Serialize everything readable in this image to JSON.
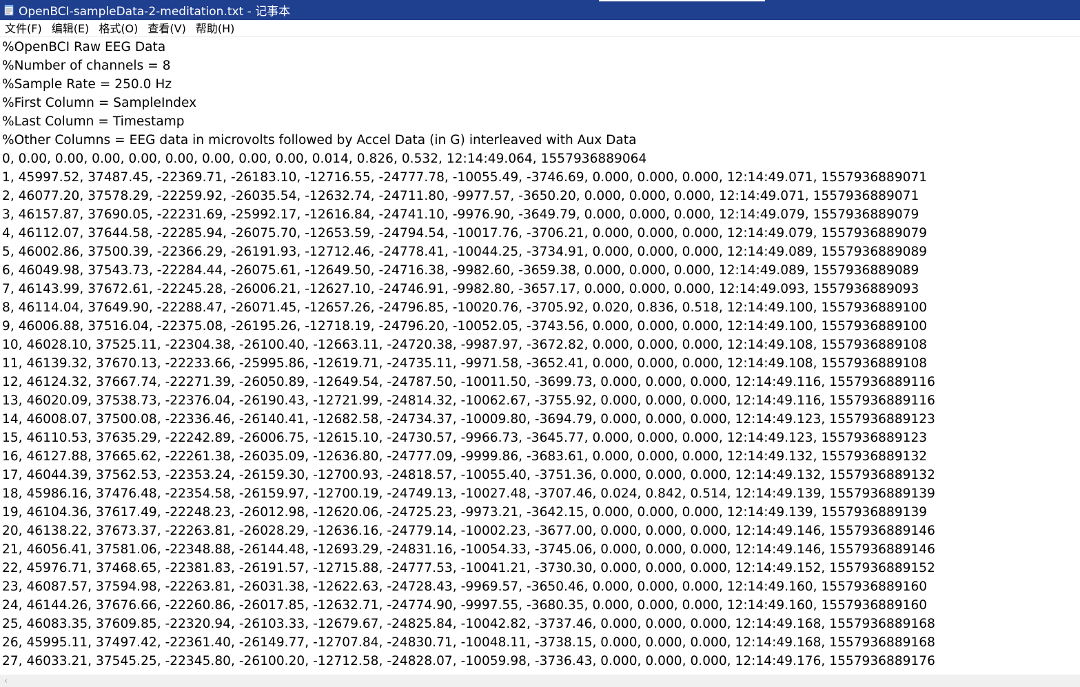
{
  "window": {
    "title": "OpenBCI-sampleData-2-meditation.txt - 记事本",
    "titlebar_color": "#1f3f8f"
  },
  "menu": {
    "items": [
      {
        "label": "文件(F)"
      },
      {
        "label": "编辑(E)"
      },
      {
        "label": "格式(O)"
      },
      {
        "label": "查看(V)"
      },
      {
        "label": "帮助(H)"
      }
    ]
  },
  "editor": {
    "lines": [
      "%OpenBCI Raw EEG Data",
      "%Number of channels = 8",
      "%Sample Rate = 250.0 Hz",
      "%First Column = SampleIndex",
      "%Last Column = Timestamp",
      "%Other Columns = EEG data in microvolts followed by Accel Data (in G) interleaved with Aux Data",
      "0, 0.00, 0.00, 0.00, 0.00, 0.00, 0.00, 0.00, 0.00, 0.014, 0.826, 0.532, 12:14:49.064, 1557936889064",
      "1, 45997.52, 37487.45, -22369.71, -26183.10, -12716.55, -24777.78, -10055.49, -3746.69, 0.000, 0.000, 0.000, 12:14:49.071, 1557936889071",
      "2, 46077.20, 37578.29, -22259.92, -26035.54, -12632.74, -24711.80, -9977.57, -3650.20, 0.000, 0.000, 0.000, 12:14:49.071, 1557936889071",
      "3, 46157.87, 37690.05, -22231.69, -25992.17, -12616.84, -24741.10, -9976.90, -3649.79, 0.000, 0.000, 0.000, 12:14:49.079, 1557936889079",
      "4, 46112.07, 37644.58, -22285.94, -26075.70, -12653.59, -24794.54, -10017.76, -3706.21, 0.000, 0.000, 0.000, 12:14:49.079, 1557936889079",
      "5, 46002.86, 37500.39, -22366.29, -26191.93, -12712.46, -24778.41, -10044.25, -3734.91, 0.000, 0.000, 0.000, 12:14:49.089, 1557936889089",
      "6, 46049.98, 37543.73, -22284.44, -26075.61, -12649.50, -24716.38, -9982.60, -3659.38, 0.000, 0.000, 0.000, 12:14:49.089, 1557936889089",
      "7, 46143.99, 37672.61, -22245.28, -26006.21, -12627.10, -24746.91, -9982.80, -3657.17, 0.000, 0.000, 0.000, 12:14:49.093, 1557936889093",
      "8, 46114.04, 37649.90, -22288.47, -26071.45, -12657.26, -24796.85, -10020.76, -3705.92, 0.020, 0.836, 0.518, 12:14:49.100, 1557936889100",
      "9, 46006.88, 37516.04, -22375.08, -26195.26, -12718.19, -24796.20, -10052.05, -3743.56, 0.000, 0.000, 0.000, 12:14:49.100, 1557936889100",
      "10, 46028.10, 37525.11, -22304.38, -26100.40, -12663.11, -24720.38, -9987.97, -3672.82, 0.000, 0.000, 0.000, 12:14:49.108, 1557936889108",
      "11, 46139.32, 37670.13, -22233.66, -25995.86, -12619.71, -24735.11, -9971.58, -3652.41, 0.000, 0.000, 0.000, 12:14:49.108, 1557936889108",
      "12, 46124.32, 37667.74, -22271.39, -26050.89, -12649.54, -24787.50, -10011.50, -3699.73, 0.000, 0.000, 0.000, 12:14:49.116, 1557936889116",
      "13, 46020.09, 37538.73, -22376.04, -26190.43, -12721.99, -24814.32, -10062.67, -3755.92, 0.000, 0.000, 0.000, 12:14:49.116, 1557936889116",
      "14, 46008.07, 37500.08, -22336.46, -26140.41, -12682.58, -24734.37, -10009.80, -3694.79, 0.000, 0.000, 0.000, 12:14:49.123, 1557936889123",
      "15, 46110.53, 37635.29, -22242.89, -26006.75, -12615.10, -24730.57, -9966.73, -3645.77, 0.000, 0.000, 0.000, 12:14:49.123, 1557936889123",
      "16, 46127.88, 37665.62, -22261.38, -26035.09, -12636.80, -24777.09, -9999.86, -3683.61, 0.000, 0.000, 0.000, 12:14:49.132, 1557936889132",
      "17, 46044.39, 37562.53, -22353.24, -26159.30, -12700.93, -24818.57, -10055.40, -3751.36, 0.000, 0.000, 0.000, 12:14:49.132, 1557936889132",
      "18, 45986.16, 37476.48, -22354.58, -26159.97, -12700.19, -24749.13, -10027.48, -3707.46, 0.024, 0.842, 0.514, 12:14:49.139, 1557936889139",
      "19, 46104.36, 37617.49, -22248.23, -26012.98, -12620.06, -24725.23, -9973.21, -3642.15, 0.000, 0.000, 0.000, 12:14:49.139, 1557936889139",
      "20, 46138.22, 37673.37, -22263.81, -26028.29, -12636.16, -24779.14, -10002.23, -3677.00, 0.000, 0.000, 0.000, 12:14:49.146, 1557936889146",
      "21, 46056.41, 37581.06, -22348.88, -26144.48, -12693.29, -24831.16, -10054.33, -3745.06, 0.000, 0.000, 0.000, 12:14:49.146, 1557936889146",
      "22, 45976.71, 37468.65, -22381.83, -26191.57, -12715.88, -24777.53, -10041.21, -3730.30, 0.000, 0.000, 0.000, 12:14:49.152, 1557936889152",
      "23, 46087.57, 37594.98, -22263.81, -26031.38, -12622.63, -24728.43, -9969.57, -3650.46, 0.000, 0.000, 0.000, 12:14:49.160, 1557936889160",
      "24, 46144.26, 37676.66, -22260.86, -26017.85, -12632.71, -24774.90, -9997.55, -3680.35, 0.000, 0.000, 0.000, 12:14:49.160, 1557936889160",
      "25, 46083.35, 37609.85, -22320.94, -26103.33, -12679.67, -24825.84, -10042.82, -3737.46, 0.000, 0.000, 0.000, 12:14:49.168, 1557936889168",
      "26, 45995.11, 37497.42, -22361.40, -26149.77, -12707.84, -24830.71, -10048.11, -3738.15, 0.000, 0.000, 0.000, 12:14:49.168, 1557936889168",
      "27, 46033.21, 37545.25, -22345.80, -26100.20, -12712.58, -24828.07, -10059.98, -3736.43, 0.000, 0.000, 0.000, 12:14:49.176, 1557936889176"
    ]
  },
  "scrollbar": {
    "left_arrow_icon": "chevron-left-icon"
  }
}
